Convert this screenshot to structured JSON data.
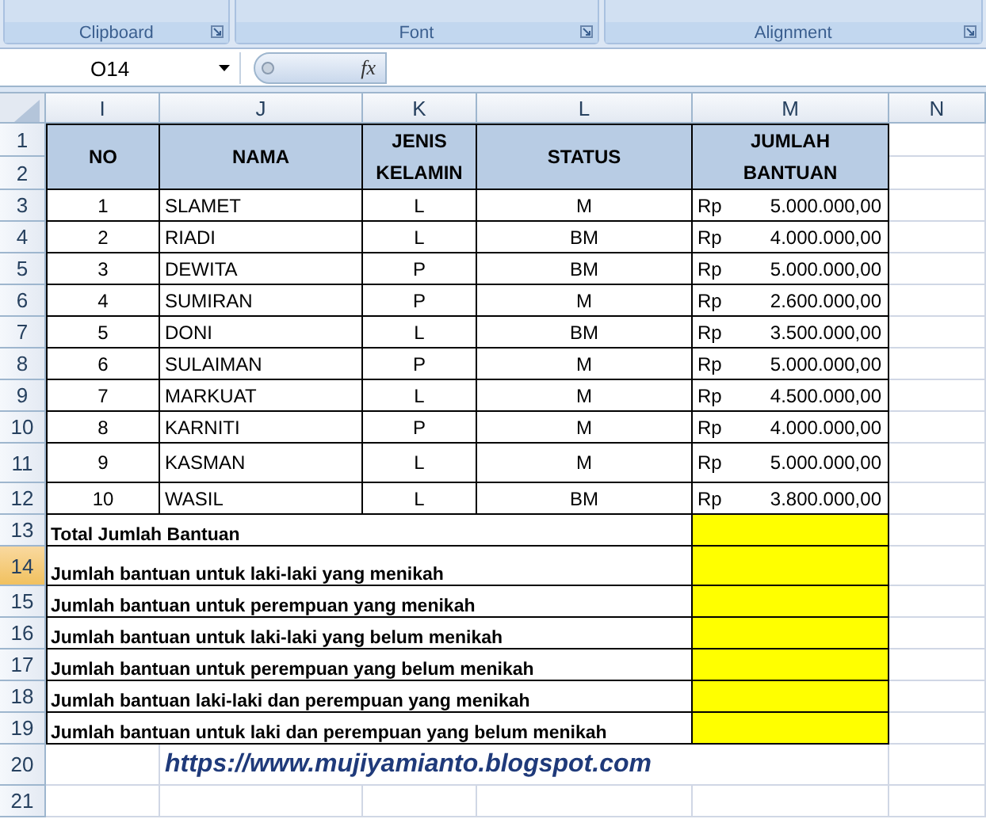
{
  "ribbon": {
    "groups": [
      {
        "label": "Clipboard"
      },
      {
        "label": "Font"
      },
      {
        "label": "Alignment"
      }
    ]
  },
  "formula_bar": {
    "name_box": "O14",
    "function_label": "fx"
  },
  "columns": [
    {
      "label": "I"
    },
    {
      "label": "J"
    },
    {
      "label": "K"
    },
    {
      "label": "L"
    },
    {
      "label": "M"
    },
    {
      "label": "N"
    }
  ],
  "row_headers": [
    {
      "label": "1",
      "selected": false
    },
    {
      "label": "2",
      "selected": false
    },
    {
      "label": "3",
      "selected": false
    },
    {
      "label": "4",
      "selected": false
    },
    {
      "label": "5",
      "selected": false
    },
    {
      "label": "6",
      "selected": false
    },
    {
      "label": "7",
      "selected": false
    },
    {
      "label": "8",
      "selected": false
    },
    {
      "label": "9",
      "selected": false
    },
    {
      "label": "10",
      "selected": false
    },
    {
      "label": "11",
      "selected": false
    },
    {
      "label": "12",
      "selected": false
    },
    {
      "label": "13",
      "selected": false
    },
    {
      "label": "14",
      "selected": true
    },
    {
      "label": "15",
      "selected": false
    },
    {
      "label": "16",
      "selected": false
    },
    {
      "label": "17",
      "selected": false
    },
    {
      "label": "18",
      "selected": false
    },
    {
      "label": "19",
      "selected": false
    },
    {
      "label": "20",
      "selected": false
    },
    {
      "label": "21",
      "selected": false
    }
  ],
  "table": {
    "headers": [
      {
        "lines": [
          "NO"
        ]
      },
      {
        "lines": [
          "NAMA"
        ]
      },
      {
        "lines": [
          "JENIS",
          "KELAMIN"
        ]
      },
      {
        "lines": [
          "STATUS"
        ]
      },
      {
        "lines": [
          "JUMLAH",
          "BANTUAN"
        ]
      }
    ],
    "rows": [
      {
        "no": "1",
        "nama": "SLAMET",
        "jenis_kelamin": "L",
        "status": "M",
        "currency": "Rp",
        "amount": "5.000.000,00"
      },
      {
        "no": "2",
        "nama": "RIADI",
        "jenis_kelamin": "L",
        "status": "BM",
        "currency": "Rp",
        "amount": "4.000.000,00"
      },
      {
        "no": "3",
        "nama": "DEWITA",
        "jenis_kelamin": "P",
        "status": "BM",
        "currency": "Rp",
        "amount": "5.000.000,00"
      },
      {
        "no": "4",
        "nama": "SUMIRAN",
        "jenis_kelamin": "P",
        "status": "M",
        "currency": "Rp",
        "amount": "2.600.000,00"
      },
      {
        "no": "5",
        "nama": "DONI",
        "jenis_kelamin": "L",
        "status": "BM",
        "currency": "Rp",
        "amount": "3.500.000,00"
      },
      {
        "no": "6",
        "nama": "SULAIMAN",
        "jenis_kelamin": "P",
        "status": "M",
        "currency": "Rp",
        "amount": "5.000.000,00"
      },
      {
        "no": "7",
        "nama": "MARKUAT",
        "jenis_kelamin": "L",
        "status": "M",
        "currency": "Rp",
        "amount": "4.500.000,00"
      },
      {
        "no": "8",
        "nama": "KARNITI",
        "jenis_kelamin": "P",
        "status": "M",
        "currency": "Rp",
        "amount": "4.000.000,00"
      },
      {
        "no": "9",
        "nama": "KASMAN",
        "jenis_kelamin": "L",
        "status": "M",
        "currency": "Rp",
        "amount": "5.000.000,00"
      },
      {
        "no": "10",
        "nama": "WASIL",
        "jenis_kelamin": "L",
        "status": "BM",
        "currency": "Rp",
        "amount": "3.800.000,00"
      }
    ],
    "summary": [
      {
        "label": "Total Jumlah Bantuan"
      },
      {
        "label": "Jumlah bantuan untuk laki-laki yang menikah"
      },
      {
        "label": "Jumlah bantuan untuk perempuan yang menikah"
      },
      {
        "label": "Jumlah bantuan untuk laki-laki yang belum menikah"
      },
      {
        "label": "Jumlah bantuan untuk perempuan yang belum menikah"
      },
      {
        "label": "Jumlah bantuan laki-laki dan perempuan yang menikah"
      },
      {
        "label": "Jumlah bantuan untuk laki dan perempuan yang belum menikah"
      }
    ]
  },
  "link": "https://www.mujiyamianto.blogspot.com"
}
